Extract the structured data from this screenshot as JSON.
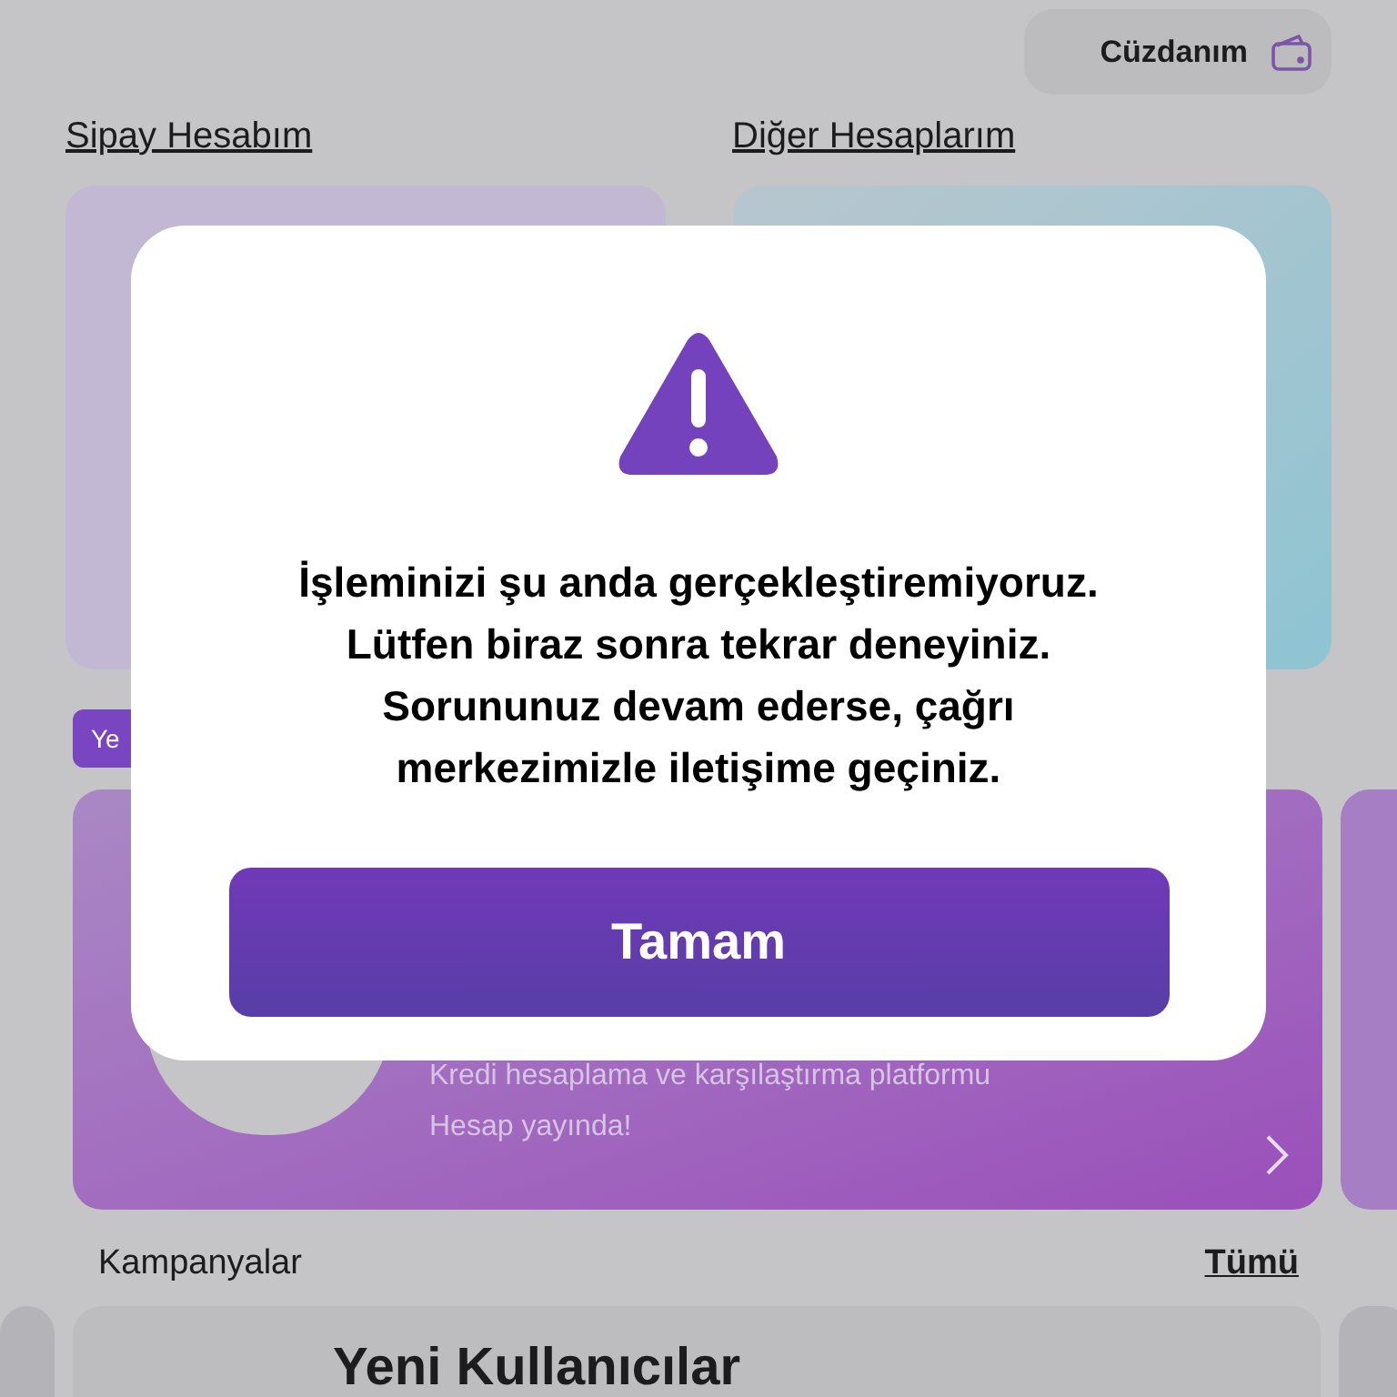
{
  "header": {
    "wallet_button": "Cüzdanım"
  },
  "sections": [
    {
      "title": "Sipay Hesabım"
    },
    {
      "title": "Diğer Hesaplarım"
    }
  ],
  "badge": "Ye",
  "banner": {
    "description": "Kredi hesaplama ve karşılaştırma platformu",
    "status": "Hesap yayında!"
  },
  "campaigns": {
    "title": "Kampanyalar",
    "link": "Tümü",
    "cards": [
      {
        "title": "Yeni Kullanıcılar"
      }
    ]
  },
  "dialog": {
    "lines": [
      "İşleminizi şu anda gerçekleştiremiyoruz.",
      "Lütfen biraz sonra tekrar deneyiniz.",
      "Sorununuz devam ederse, çağrı",
      "merkezimizle iletişime geçiniz."
    ],
    "button": "Tamam"
  }
}
